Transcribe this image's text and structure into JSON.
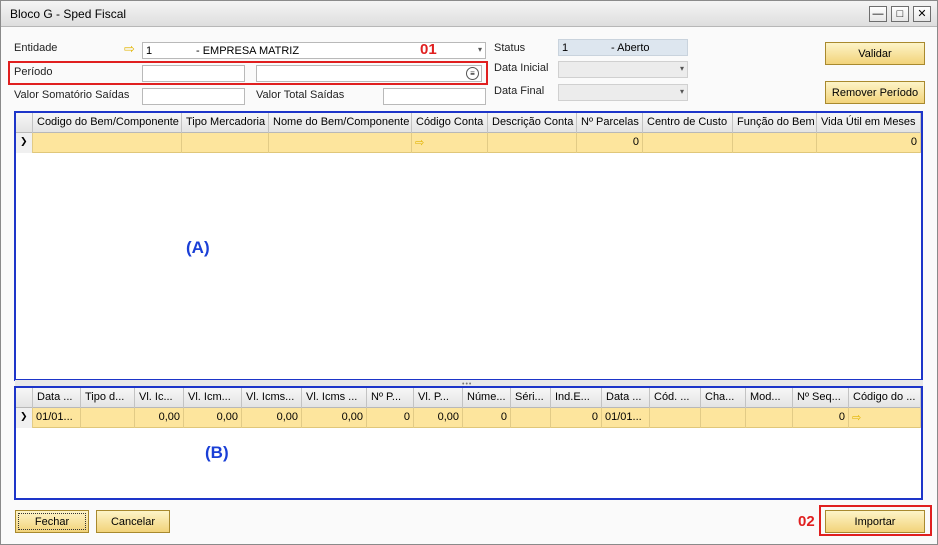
{
  "window": {
    "title": "Bloco G - Sped Fiscal",
    "minimize": "—",
    "maximize": "□",
    "close": "✕"
  },
  "form": {
    "entidade_label": "Entidade",
    "entidade_code": "1",
    "entidade_name": "- EMPRESA MATRIZ",
    "periodo_label": "Período",
    "periodo_value": "",
    "periodo_desc": "",
    "valor_somatorio_label": "Valor Somatório Saídas",
    "valor_somatorio_value": "",
    "valor_total_label": "Valor Total Saídas",
    "valor_total_value": "",
    "status_label": "Status",
    "status_code": "1",
    "status_value": "- Aberto",
    "data_inicial_label": "Data Inicial",
    "data_inicial_value": "",
    "data_final_label": "Data Final",
    "data_final_value": ""
  },
  "buttons": {
    "validar": "Validar",
    "remover_periodo": "Remover Período",
    "fechar": "Fechar",
    "cancelar": "Cancelar",
    "importar": "Importar"
  },
  "annotations": {
    "a": "(A)",
    "b": "(B)",
    "n01": "01",
    "n02": "02"
  },
  "grid_a": {
    "columns": [
      "Codigo do Bem/Componente",
      "Tipo Mercadoria",
      "Nome do Bem/Componente",
      "Código Conta",
      "Descrição Conta",
      "Nº Parcelas",
      "Centro de Custo",
      "Função do Bem",
      "Vida Útil em Meses"
    ],
    "row": [
      "",
      "",
      "",
      "⇨",
      "",
      "0",
      "",
      "",
      "0"
    ]
  },
  "grid_b": {
    "columns": [
      "Data ...",
      "Tipo d...",
      "Vl. Ic...",
      "Vl. Icm...",
      "Vl. Icms...",
      "Vl. Icms ...",
      "Nº P...",
      "Vl. P...",
      "Núme...",
      "Séri...",
      "Ind.E...",
      "Data ...",
      "Cód. ...",
      "Cha...",
      "Mod...",
      "Nº Seq...",
      "Código do ..."
    ],
    "row": [
      "01/01...",
      "",
      "0,00",
      "0,00",
      "0,00",
      "0,00",
      "0",
      "0,00",
      "0",
      "",
      "0",
      "01/01...",
      "",
      "",
      "",
      "0",
      "⇨"
    ]
  },
  "colors": {
    "accent_blue": "#1d35c9",
    "annotation_red": "#e01f1f",
    "row_yellow": "#fde59d",
    "button_gold": "#f2d37a"
  }
}
